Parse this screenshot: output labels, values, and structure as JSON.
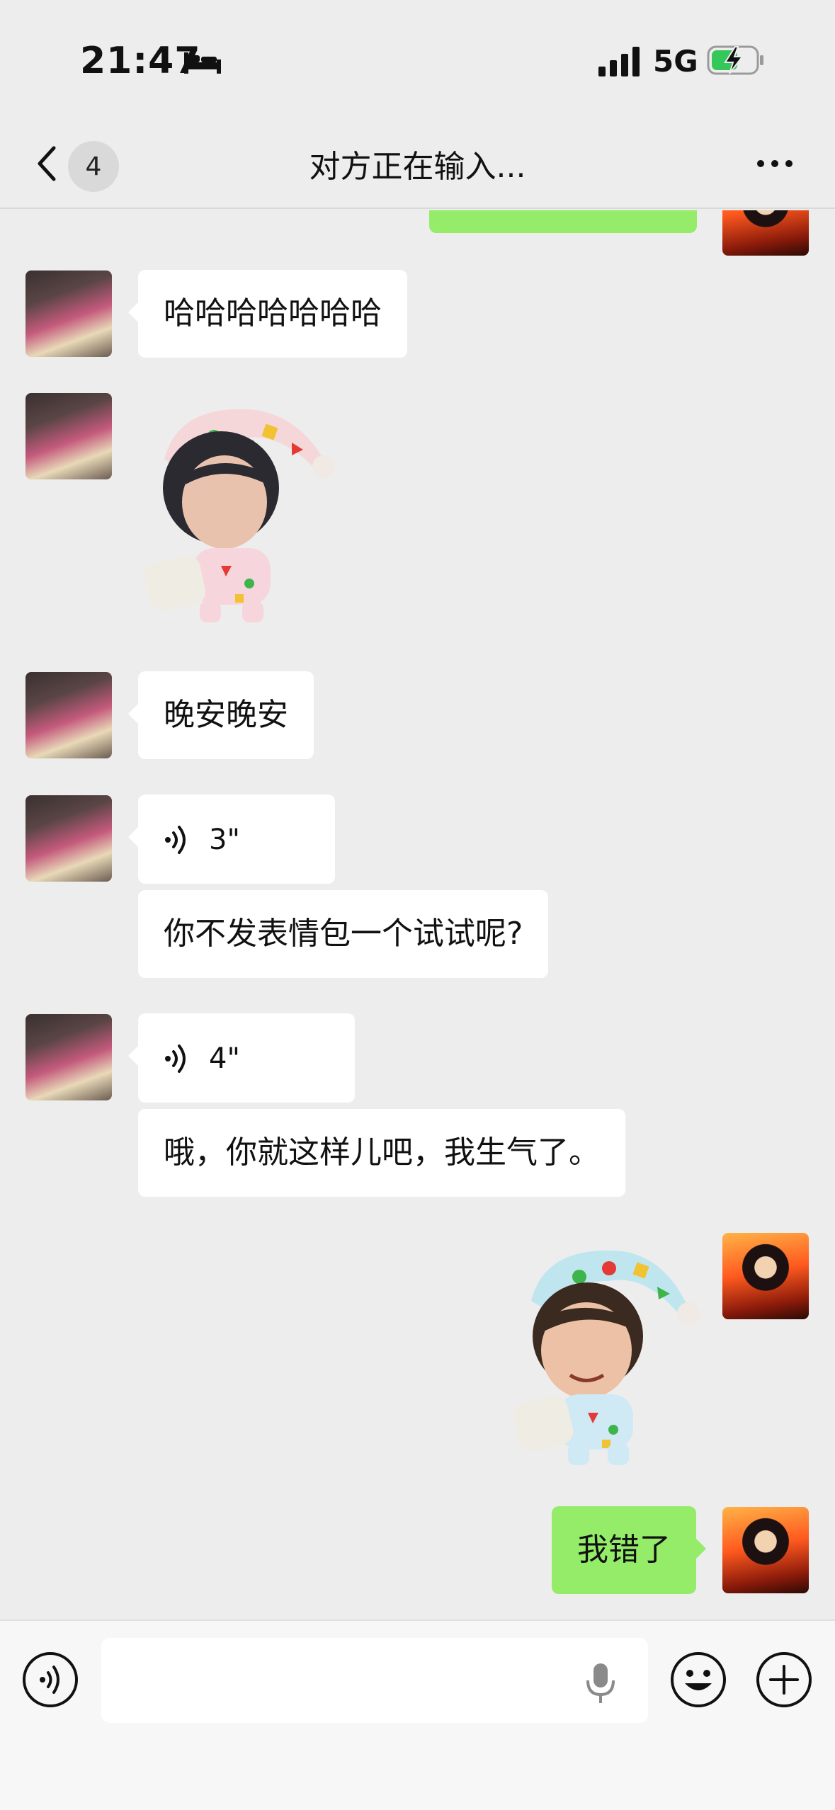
{
  "status_bar": {
    "time": "21:47",
    "network": "5G",
    "icons": [
      "bed-icon",
      "signal-icon",
      "battery-charging-icon"
    ]
  },
  "nav": {
    "unread_count": "4",
    "title": "对方正在输入...",
    "icons": [
      "back-chevron-icon",
      "more-icon"
    ]
  },
  "messages": [
    {
      "from": "friend",
      "kind": "text",
      "text": "哈哈哈哈哈哈哈"
    },
    {
      "from": "friend",
      "kind": "sticker",
      "sticker": "boy-pink-pajamas-sticker"
    },
    {
      "from": "friend",
      "kind": "text",
      "text": "晚安晚安"
    },
    {
      "from": "friend",
      "kind": "voice",
      "duration": "3\""
    },
    {
      "from": "friend",
      "kind": "text",
      "text": "你不发表情包一个试试呢?"
    },
    {
      "from": "friend",
      "kind": "voice",
      "duration": "4\""
    },
    {
      "from": "friend",
      "kind": "text",
      "text": "哦，你就这样儿吧，我生气了。"
    },
    {
      "from": "me",
      "kind": "sticker",
      "sticker": "boy-blue-pajamas-sticker"
    },
    {
      "from": "me",
      "kind": "text",
      "text": "我错了"
    }
  ],
  "input_bar": {
    "placeholder": "",
    "icons": [
      "voice-mode-icon",
      "mic-icon",
      "emoji-icon",
      "plus-icon"
    ]
  },
  "colors": {
    "background": "#ededed",
    "incoming_bubble": "#ffffff",
    "outgoing_bubble": "#95ec69",
    "input_bar": "#f7f7f7"
  }
}
